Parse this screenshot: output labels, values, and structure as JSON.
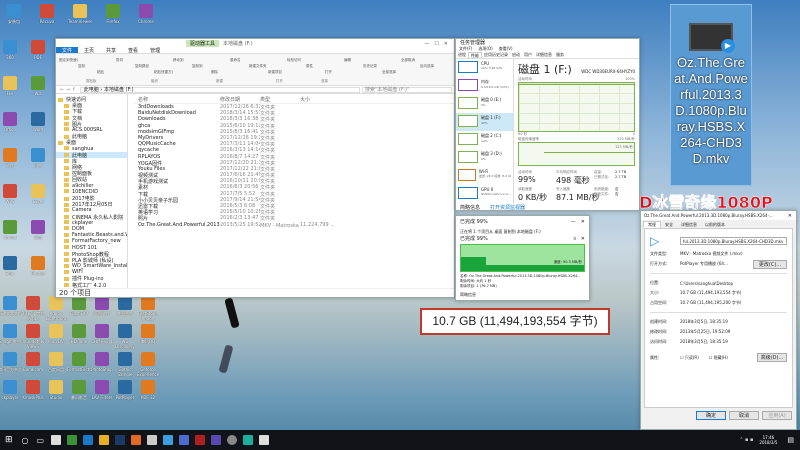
{
  "desktop": {
    "top_icons": [
      "安装包",
      "Recuva",
      "TeamViewer",
      "Firefox",
      "Chrome"
    ],
    "left_icons": [
      "360",
      "PDF",
      "FLV",
      "Wiz",
      "Office",
      "Word",
      "软件",
      "迅雷",
      "WPS",
      "Excel",
      "Xmind",
      "网盘",
      "Snip",
      "Photos"
    ],
    "bottom_icons": [
      "新建文本文档",
      "2017年度总结.ppt",
      "Adobe Lightroom",
      "FlashFXP",
      "画图软件",
      "美图秀秀",
      "FastStone Image",
      "Snagit 截图",
      "InClude超级 ViewS",
      "Miro DV",
      "HD Tune",
      "CHM阅读器",
      "WD Discovery",
      "腾讯QQ",
      "腾讯官方杂志",
      "Bandicam",
      "百度网盘",
      "FormatFactory",
      "PhotoShop",
      "Gothic Sample",
      "Geforce Experience",
      "ckplayer",
      "KinoskPlus",
      "Studio",
      "暴风影音",
      "LAV Filters",
      "PotPlayer",
      "PDF 32"
    ],
    "file_tile": "Oz.The.Great.And.Powerful.2013.3D.1080p.Bluray.HSBS.X264-CHD3D.mkv",
    "overlay_title": "3D冰雪奇缘1080P",
    "size_callout": "10.7 GB (11,494,193,554 字节)"
  },
  "explorer": {
    "title": "本地磁盘 (F:)",
    "context_tab": "驱动器工具",
    "ribbon_tabs": [
      "文件",
      "主页",
      "共享",
      "查看",
      "管理"
    ],
    "ribbon_groups": [
      "剪贴板",
      "组织",
      "新建",
      "打开",
      "选择"
    ],
    "ribbon_buttons": [
      "固定到快速访问",
      "复制",
      "粘贴",
      "剪切",
      "复制路径",
      "粘贴快捷方式",
      "移动到",
      "复制到",
      "删除",
      "重命名",
      "新建文件夹",
      "新建项目",
      "轻松访问",
      "属性",
      "打开",
      "编辑",
      "历史记录",
      "全部选择",
      "全部取消",
      "反向选择"
    ],
    "address": [
      "此电脑",
      "本地磁盘 (F:)"
    ],
    "search_placeholder": "搜索\"本地磁盘 (F:)\"",
    "columns": [
      "名称",
      "修改日期",
      "类型",
      "大小"
    ],
    "sidebar": [
      "快速访问",
      "桌面",
      "下载",
      "文档",
      "图片",
      "ACS.000SRL",
      "此电脑",
      "桌面",
      "sanghua",
      "此电脑",
      "库",
      "网络",
      "控制面板",
      "回收站",
      "a9chiller",
      "10ENCDID",
      "2017电影",
      "2017年12月05日",
      "Camera",
      "CINEMA 永久私人影院",
      "ckplayer",
      "DOM",
      "Fantastic.Beasts.and.Where.to.Fi",
      "FormatFactory_new",
      "HOST 101",
      "PhotoShop教程",
      "PLA 影城师 (私设)",
      "WD_SmartWare_Installer_2.4.20",
      "WIFI",
      "插件 Plug-ins",
      "格式工厂 4.2.0"
    ],
    "files": [
      [
        "3rdDownloads",
        "2017/12/26 6:32",
        "文件夹",
        ""
      ],
      [
        "BaiduNetdiskDownload",
        "2018/3/14 15:51",
        "文件夹",
        ""
      ],
      [
        "Downloads",
        "2018/3/3 16:38",
        "文件夹",
        ""
      ],
      [
        "ghca",
        "2015/6/10 19:12",
        "文件夹",
        ""
      ],
      [
        "modsimGIFmp",
        "2015/8/3 16:41",
        "文件夹",
        ""
      ],
      [
        "MyDrivers",
        "2017/12/28 19:29",
        "文件夹",
        ""
      ],
      [
        "QQMusicCache",
        "2017/3/11 14:04",
        "文件夹",
        ""
      ],
      [
        "qycache",
        "2016/3/13 14:14",
        "文件夹",
        ""
      ],
      [
        "RPLAYOS",
        "2016/8/7 14:27",
        "文件夹",
        ""
      ],
      [
        "YOGA固件",
        "2017/12/20 21:30",
        "文件夹",
        ""
      ],
      [
        "Youku Files",
        "2017/12/22 21:07",
        "文件夹",
        ""
      ],
      [
        "视频测试",
        "2017/6/16 21:49",
        "文件夹",
        ""
      ],
      [
        "手机游戏测试",
        "2016/10/11 20:02",
        "文件夹",
        ""
      ],
      [
        "素材",
        "2016/6/3 20:56",
        "文件夹",
        ""
      ],
      [
        "下载",
        "2017/7/5 5:52",
        "文件夹",
        ""
      ],
      [
        "小小贝贝亲子乐园",
        "2017/9/14 21:54",
        "文件夹",
        ""
      ],
      [
        "迅雷下载",
        "2016/5/3 6:08",
        "文件夹",
        ""
      ],
      [
        "英语学习",
        "2016/5/10 10:26",
        "文件夹",
        ""
      ],
      [
        "照片",
        "2016/2/3 13:47",
        "文件夹",
        ""
      ],
      [
        "Oz.The.Great.And.Powerful.2013.3D.1080p...",
        "2013/5/25 19:52",
        "MKV - Matroska 视...",
        "11,224,799 ..."
      ]
    ],
    "status": "20 个项目"
  },
  "taskmgr": {
    "title": "任务管理器",
    "menu": [
      "文件(F)",
      "选项(O)",
      "查看(V)"
    ],
    "tabs": [
      "进程",
      "性能",
      "应用历史记录",
      "启动",
      "用户",
      "详细信息",
      "服务"
    ],
    "list": [
      [
        "CPU",
        "20% 3.98 GHz"
      ],
      [
        "内存",
        "6.9/16.0 GB (43%)"
      ],
      [
        "磁盘 0 (E:)",
        "0%"
      ],
      [
        "磁盘 1 (F:)",
        "99%"
      ],
      [
        "磁盘 2 (C:)",
        "14%"
      ],
      [
        "磁盘 3 (D:)",
        "0%"
      ],
      [
        "Wi-Fi",
        "发送: 24.0 接收: 8.0 Kbps"
      ],
      [
        "GPU 0",
        "NVIDIA GeForce G..."
      ]
    ],
    "heading": "磁盘 1 (F:)",
    "model": "WDC WD30EURX-64HYZY0",
    "chart1_label": "活动时间",
    "chart1_max": "100%",
    "chart1_bottom": "60 秒",
    "chart1_zero": "0",
    "chart2_label": "磁盘传输速率",
    "chart2_max": "250 MB/秒",
    "chart2_mid": "125 MB/秒",
    "stats": [
      [
        "活动时间",
        "99%"
      ],
      [
        "平均响应时间",
        "498 毫秒"
      ],
      [
        "读取速度",
        "0 KB/秒"
      ],
      [
        "写入速度",
        "87.1 MB/秒"
      ]
    ],
    "info": [
      [
        "容量:",
        "2.7 TB"
      ],
      [
        "已格式化:",
        "2.7 TB"
      ],
      [
        "系统磁盘:",
        "否"
      ],
      [
        "页面文件:",
        "否"
      ]
    ],
    "footer": [
      "简略信息",
      "打开资源监视器"
    ]
  },
  "copy": {
    "title": "已完成 99%",
    "line1": "正在将 1 个项目从 桌面 复制到 本地磁盘 (F:)",
    "progress_text": "已完成 99%",
    "progress": 0.99,
    "speed": "速度: 90.3 MB/秒",
    "name": "名称: Oz.The.Great.And.Powerful.2013.3D.1080p.Bluray.HSBS.X264...",
    "remaining_time": "剩余时间: 大约 1 秒",
    "remaining_items": "剩余项目: 1 (76.7 MB)",
    "footer": "简略信息"
  },
  "props": {
    "title": "Oz.The.Great.And.Powerful.2013.3D.1080p.Bluray.HSBS.X264-...",
    "tabs": [
      "常规",
      "安全",
      "详细信息",
      "以前的版本"
    ],
    "filename": "ful.2013.3D.1080p.Bluray.HSBS.X264-CHD3D.mkv",
    "rows": [
      [
        "文件类型:",
        "MKV - Matroska 视频文件 (.mkv)"
      ],
      [
        "打开方式:",
        "PotPlayer 专用播放 (64..."
      ],
      [
        "位置:",
        "C:\\Users\\sanghua\\Desktop"
      ],
      [
        "大小:",
        "10.7 GB (11,494,193,554 字节)"
      ],
      [
        "占用空间:",
        "10.7 GB (11,494,195,200 字节)"
      ],
      [
        "创建时间:",
        "2018年3月5日, 18:35:19"
      ],
      [
        "修改时间:",
        "2013年5月25日, 19:52:09"
      ],
      [
        "访问时间:",
        "2018年3月5日, 18:35:19"
      ]
    ],
    "change": "更改(C)...",
    "attr_label": "属性:",
    "readonly": "只读(R)",
    "hidden": "隐藏(H)",
    "advanced": "高级(D)...",
    "ok": "确定",
    "cancel": "取消",
    "apply": "应用(A)"
  },
  "taskbar": {
    "time": "17:46",
    "date": "2018/3/5"
  },
  "colors": {
    "accent": "#1979ca",
    "overlay_red": "#e0141e",
    "copy_green": "#4cc04c",
    "disk_green": "#7fb24e"
  }
}
